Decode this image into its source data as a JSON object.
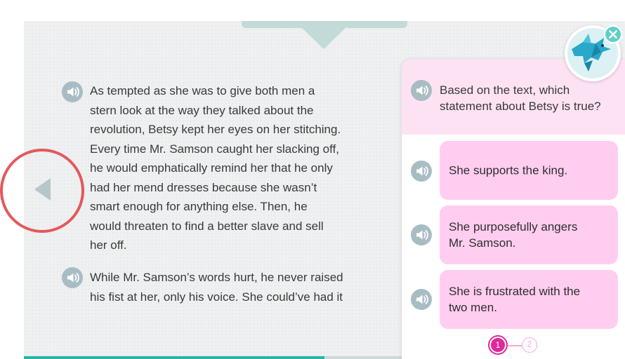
{
  "passage": {
    "paragraphs": [
      {
        "lines": [
          "As tempted as she was to give both men a",
          "stern look at the way they talked about the",
          "revolution, Betsy kept her eyes on her stitching.",
          "Every time Mr. Samson caught her slacking off,",
          "he would emphatically remind her that he only",
          "had her mend dresses because she wasn’t",
          "smart enough for anything else. Then, he",
          "would threaten to find a better slave and sell",
          "her off."
        ]
      },
      {
        "lines": [
          "While Mr. Samson’s words hurt, he never raised",
          "his fist at her, only his voice. She could’ve had it"
        ]
      }
    ]
  },
  "quiz": {
    "question_lines": [
      "Based on the text, which",
      "statement about Betsy is true?"
    ],
    "answers": [
      {
        "lines": [
          "She supports the king."
        ]
      },
      {
        "lines": [
          "She purposefully angers",
          "Mr. Samson."
        ]
      },
      {
        "lines": [
          "She is frustrated with the",
          "two men."
        ]
      }
    ]
  },
  "pagination": {
    "current": "1",
    "next": "2"
  },
  "reading_progress": 0.5,
  "icons": {
    "audio": "speaker-icon",
    "back": "triangle-left-icon",
    "close": "close-icon",
    "avatar": "dragon-mascot-icon",
    "top_tab": "chevron-down-icon"
  },
  "colors": {
    "stage_bg": "#eef0f1",
    "speaker": "#a8bcc3",
    "highlight_ring": "#e4585c",
    "question_bg": "#fde2f3",
    "answer_bg": "#ffcdef",
    "pager_active": "#e0279b",
    "progress": "#2ab3a6",
    "close": "#5ed0c8"
  }
}
